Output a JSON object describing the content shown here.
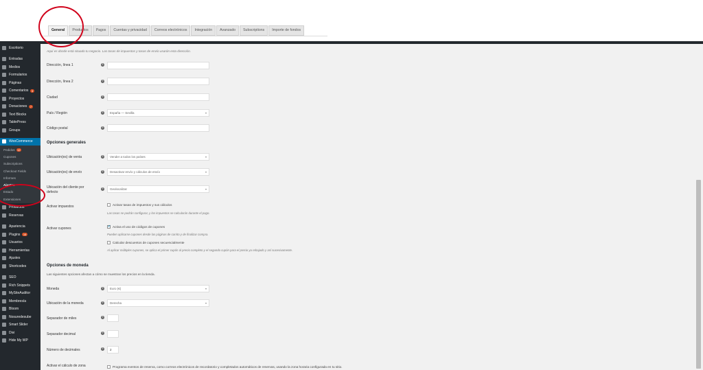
{
  "tabs": [
    "General",
    "Productos",
    "Pagos",
    "Cuentas y privacidad",
    "Correos electrónicos",
    "Integración",
    "Avanzado",
    "Subscriptions",
    "Importe de fondos"
  ],
  "sidebar": {
    "top_items": [
      {
        "label": "Escritorio"
      },
      {
        "label": "Entradas"
      },
      {
        "label": "Medios"
      },
      {
        "label": "Formularios"
      },
      {
        "label": "Páginas"
      },
      {
        "label": "Comentarios",
        "badge": "3"
      },
      {
        "label": "Proyectos"
      },
      {
        "label": "Donaciones",
        "badge": "7"
      },
      {
        "label": "Text Blocks"
      },
      {
        "label": "TablePress"
      },
      {
        "label": "Groups"
      }
    ],
    "woocommerce": {
      "label": "WooCommerce"
    },
    "woo_submenu": [
      {
        "label": "Pedidos",
        "badge": "12"
      },
      {
        "label": "Cupones"
      },
      {
        "label": "Subscriptions"
      },
      {
        "label": "Checkout Fields"
      },
      {
        "label": "Informes"
      },
      {
        "label": "Ajustes"
      },
      {
        "label": "Estado"
      },
      {
        "label": "Extensiones"
      }
    ],
    "bottom_items": [
      {
        "label": "Productos"
      },
      {
        "label": "Reservas"
      },
      {
        "label": "Apariencia"
      },
      {
        "label": "Plugins",
        "badge": "16"
      },
      {
        "label": "Usuarios"
      },
      {
        "label": "Herramientas"
      },
      {
        "label": "Ajustes"
      },
      {
        "label": "Shortcodes"
      },
      {
        "label": "SEO"
      },
      {
        "label": "Rich Snippets"
      },
      {
        "label": "MySiteAuditor"
      },
      {
        "label": "Membresía"
      },
      {
        "label": "Bloom"
      },
      {
        "label": "Nosuredesube"
      },
      {
        "label": "Smart Slider"
      },
      {
        "label": "Divi"
      },
      {
        "label": "Hide My WP"
      }
    ]
  },
  "store": {
    "intro": "Aquí es donde está situado tu negocio. Las tasas de impuestos y tasas de envío usarán esta dirección.",
    "address1_label": "Dirección, línea 1",
    "address2_label": "Dirección, línea 2",
    "city_label": "Ciudad",
    "country_label": "País / Región",
    "country_value": "España — Sevilla",
    "postcode_label": "Código postal"
  },
  "general": {
    "title": "Opciones generales",
    "sell_label": "Ubicación(es) de venta",
    "sell_value": "Vender a todos los países",
    "ship_label": "Ubicación(es) de envío",
    "ship_value": "Desactivar envío y cálculos de envío",
    "customer_label_1": "Ubicación del cliente por",
    "customer_label_2": "defecto",
    "customer_value": "Geolocalizar",
    "taxes_label": "Activar impuestos",
    "taxes_check": "Activar tasas de impuestos y sus cálculos",
    "taxes_desc": "Las tasas se podrán configurar, y los impuestos se calcularán durante el pago.",
    "coupons_label": "Activar cupones",
    "coupons_check": "Activa el uso de códigos de cupones",
    "coupons_desc": "Pueden aplicarse cupones desde las páginas de carrito y de finalizar compra.",
    "sequential_check": "Calcular descuentos de cupones secuencialmente",
    "sequential_desc": "Al aplicar múltiples cupones, se aplica el primer cupón al precio completo y el segundo cupón para el precio ya rebajado y así sucesivamente."
  },
  "currency": {
    "title": "Opciones de moneda",
    "desc": "Las siguientes opciones afectan a cómo se muestran los precios en la tienda.",
    "currency_label": "Moneda",
    "currency_value": "Euro (€)",
    "position_label": "Ubicación de la moneda",
    "position_value": "Derecha",
    "thousand_label": "Separador de miles",
    "decimal_label": "Separador decimal",
    "decimals_label": "Número de decimales",
    "decimals_value": "2",
    "timezone_label": "Activar el cálculo de zona",
    "timezone_check": "Programa eventos de reserva, como correos electrónicos de recordatorio y completados automáticos de reservas, usando la zona horaria configurada en tu sitio."
  },
  "colors": {
    "sidebar": "#23282d",
    "accent": "#0073aa",
    "annotation": "#d0021b"
  }
}
